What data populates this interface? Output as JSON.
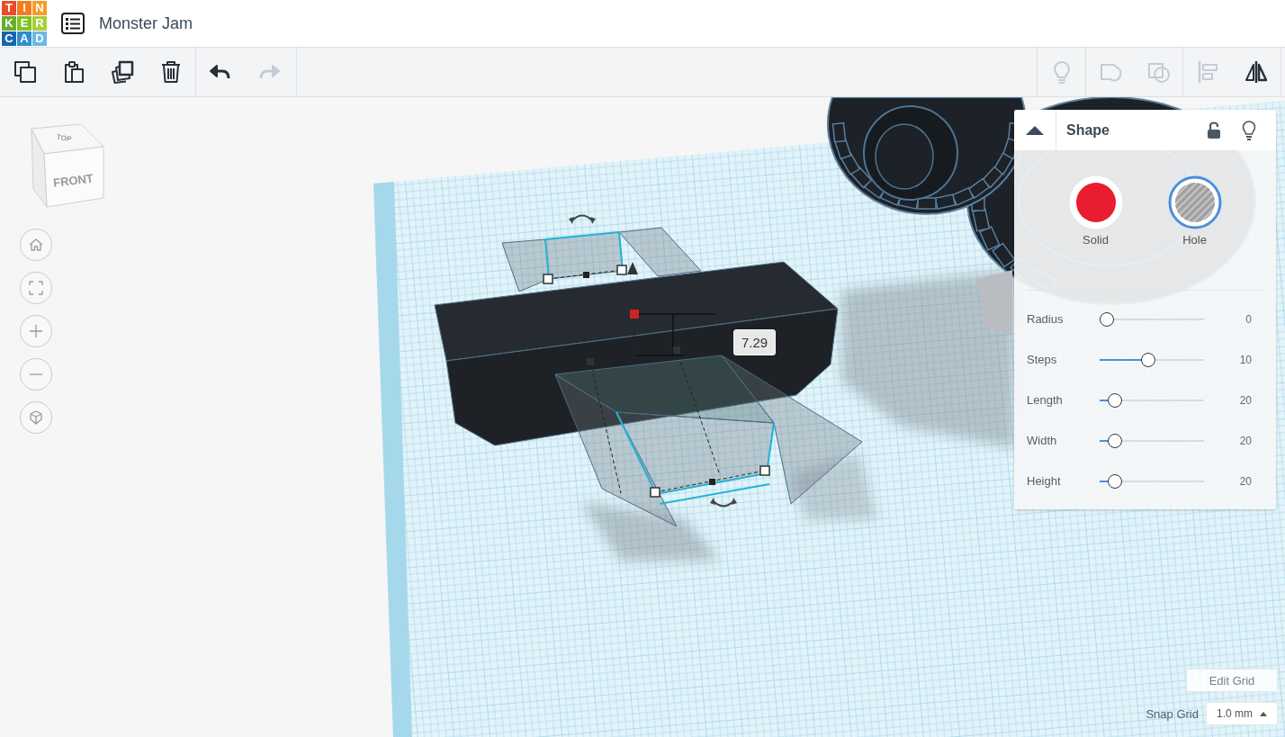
{
  "header": {
    "logo": [
      {
        "letter": "T",
        "color": "#ea4c2a"
      },
      {
        "letter": "I",
        "color": "#f47c20"
      },
      {
        "letter": "N",
        "color": "#f79b2c"
      },
      {
        "letter": "K",
        "color": "#6aad2e"
      },
      {
        "letter": "E",
        "color": "#83c21f"
      },
      {
        "letter": "R",
        "color": "#a9cd3d"
      },
      {
        "letter": "C",
        "color": "#1766b2"
      },
      {
        "letter": "A",
        "color": "#2f8ed1"
      },
      {
        "letter": "D",
        "color": "#6cb8e3"
      }
    ],
    "title": "Monster Jam"
  },
  "toolbar": {
    "left": [
      {
        "kind": "copy",
        "disabled": false
      },
      {
        "kind": "paste",
        "disabled": false
      },
      {
        "kind": "duplicate",
        "disabled": false
      },
      {
        "kind": "delete",
        "disabled": false
      }
    ],
    "history": [
      {
        "kind": "undo",
        "disabled": false
      },
      {
        "kind": "redo",
        "disabled": true
      }
    ],
    "right": [
      {
        "kind": "notes",
        "disabled": true
      },
      {
        "kind": "group",
        "disabled": true
      },
      {
        "kind": "ungroup",
        "disabled": true
      },
      {
        "kind": "align",
        "disabled": true
      },
      {
        "kind": "mirror",
        "disabled": false
      }
    ]
  },
  "view_cube": {
    "top": "TOP",
    "front": "FRONT"
  },
  "nav_buttons": [
    {
      "kind": "home"
    },
    {
      "kind": "fit"
    },
    {
      "kind": "zoom_in"
    },
    {
      "kind": "zoom_out"
    },
    {
      "kind": "projection"
    }
  ],
  "dimension_label": "7.29",
  "shape_panel": {
    "title": "Shape",
    "expanded": true,
    "locked": false,
    "types": [
      {
        "kind": "solid",
        "label": "Solid",
        "selected": false
      },
      {
        "kind": "hole",
        "label": "Hole",
        "selected": true
      }
    ],
    "params": [
      {
        "label": "Radius",
        "value": "0",
        "level": 0
      },
      {
        "label": "Steps",
        "value": "10",
        "level": 0.46
      },
      {
        "label": "Length",
        "value": "20",
        "level": 0.09
      },
      {
        "label": "Width",
        "value": "20",
        "level": 0.09
      },
      {
        "label": "Height",
        "value": "20",
        "level": 0.09
      }
    ]
  },
  "grid_controls": {
    "edit_button": "Edit Grid",
    "snap_label": "Snap Grid",
    "snap_value": "1.0 mm"
  }
}
